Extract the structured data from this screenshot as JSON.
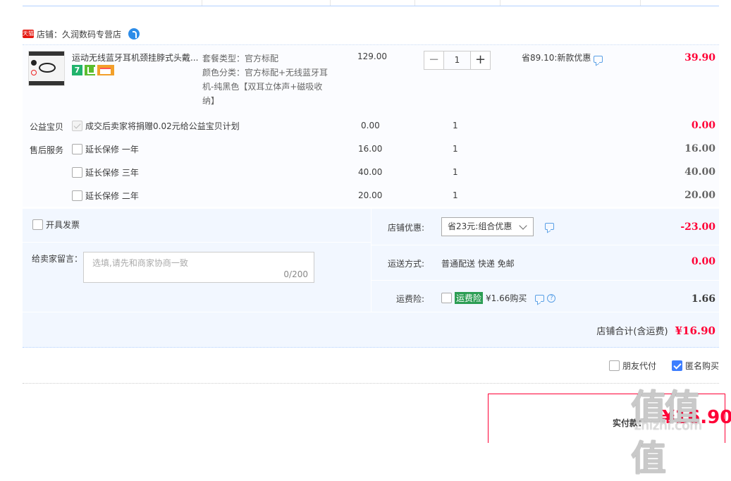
{
  "shop": {
    "name": "店铺：久润数码专营店",
    "tmall_badge": "天猫"
  },
  "item": {
    "title": "运动无线蓝牙耳机颈挂脖式头戴...",
    "props": [
      "套餐类型：官方标配",
      "颜色分类：官方标配+无线蓝牙耳机-纯黑色【双耳立体声+磁吸收纳】"
    ],
    "badge7": "7",
    "price": "129.00",
    "qty": "1",
    "qty_minus": "−",
    "qty_plus": "+",
    "discount": "省89.10:新款优惠",
    "subtotal": "39.90"
  },
  "services": [
    {
      "group": "公益宝贝",
      "label": "成交后卖家将捐赠0.02元给公益宝贝计划",
      "price": "0.00",
      "qty": "1",
      "total": "0.00",
      "locked": true
    },
    {
      "group": "售后服务",
      "label": "延长保修 一年",
      "price": "16.00",
      "qty": "1",
      "total": "16.00"
    },
    {
      "group": "",
      "label": "延长保修 三年",
      "price": "40.00",
      "qty": "1",
      "total": "40.00"
    },
    {
      "group": "",
      "label": "延长保修 二年",
      "price": "20.00",
      "qty": "1",
      "total": "20.00"
    }
  ],
  "order": {
    "invoice": "开具发票",
    "message_label": "给卖家留言：",
    "message_placeholder": "选填,请先和商家协商一致",
    "message_count": "0/200",
    "shop_discount_label": "店铺优惠:",
    "shop_discount_value": "省23元:组合优惠",
    "shop_discount_amount": "-23.00",
    "shipping_label": "运送方式:",
    "shipping_value": "普通配送 快递 免邮",
    "shipping_amount": "0.00",
    "insurance_label": "运费险:",
    "insurance_tag": "运费险",
    "insurance_value": "¥1.66购买",
    "insurance_amount": "1.66",
    "help": "?",
    "total_label": "店铺合计(含运费)",
    "total_value": "¥16.90"
  },
  "options": {
    "friend_pay": "朋友代付",
    "anonymous": "匿名购买"
  },
  "payment": {
    "label": "实付款：",
    "value": "¥16.90"
  },
  "watermark": {
    "main": "值值值",
    "sub": "zhizhi.com"
  },
  "colors": {
    "price_red": "#ff0036",
    "bg_blue": "#f2f7ff",
    "check_blue": "#3d7eff",
    "insurance_green": "#2b9d53"
  }
}
